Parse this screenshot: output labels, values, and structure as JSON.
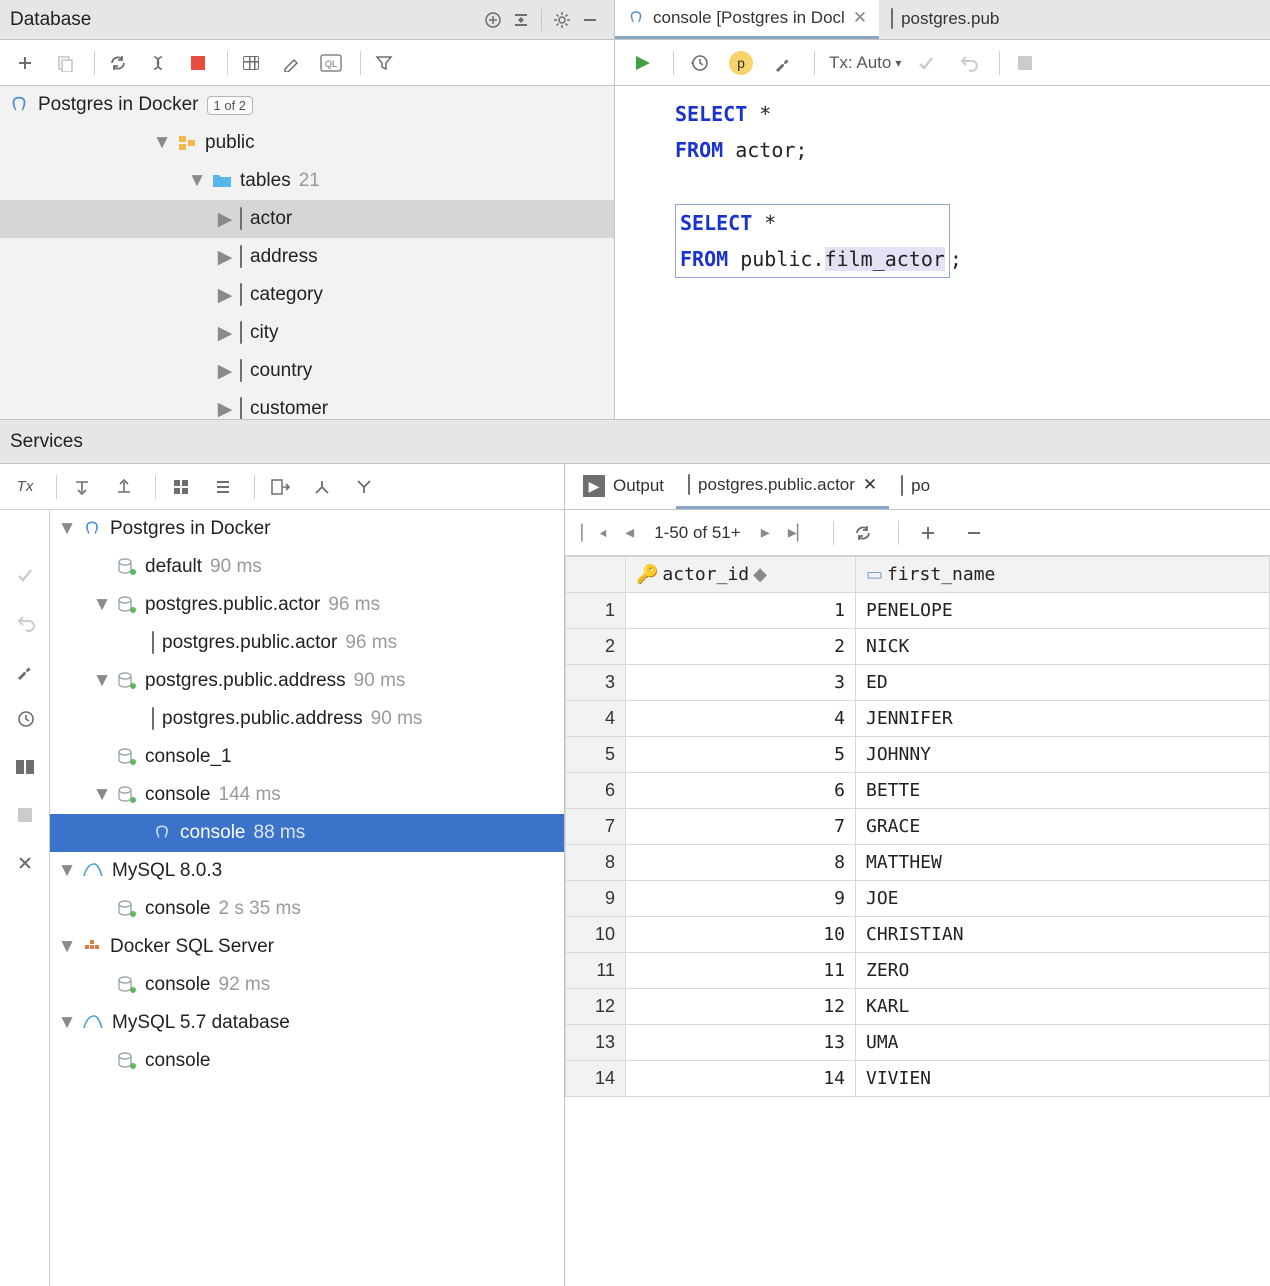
{
  "db_panel": {
    "title": "Database",
    "root": {
      "label": "Postgres in Docker",
      "pill": "1 of 2"
    },
    "schema": "public",
    "tables_label": "tables",
    "tables_count": "21",
    "tables": [
      "actor",
      "address",
      "category",
      "city",
      "country",
      "customer"
    ],
    "selected_table_index": 0
  },
  "editor": {
    "tabs": [
      {
        "label": "console [Postgres in Docl",
        "active": true,
        "closable": true,
        "icon": "elephant"
      },
      {
        "label": "postgres.pub",
        "active": false,
        "closable": false,
        "icon": "table"
      }
    ],
    "tx_label": "Tx: Auto",
    "code": {
      "l1_kw": "SELECT",
      "l1_rest": " *",
      "l2_kw": "FROM",
      "l2_rest": " actor;",
      "l3_kw": "SELECT",
      "l3_rest": " *",
      "l4_kw": "FROM",
      "l4_mid": " public.",
      "l4_hl": "film_actor",
      "l4_end": ";"
    }
  },
  "services": {
    "title": "Services",
    "tx_label": "Tx",
    "tree": [
      {
        "depth": 0,
        "arrow": "down",
        "icon": "elephant-blue",
        "label": "Postgres in Docker",
        "meta": ""
      },
      {
        "depth": 1,
        "arrow": "",
        "icon": "datasource",
        "label": "default",
        "meta": "90 ms"
      },
      {
        "depth": 1,
        "arrow": "down",
        "icon": "datasource",
        "label": "postgres.public.actor",
        "meta": "96 ms"
      },
      {
        "depth": 2,
        "arrow": "",
        "icon": "table",
        "label": "postgres.public.actor",
        "meta": "96 ms"
      },
      {
        "depth": 1,
        "arrow": "down",
        "icon": "datasource",
        "label": "postgres.public.address",
        "meta": "90 ms"
      },
      {
        "depth": 2,
        "arrow": "",
        "icon": "table",
        "label": "postgres.public.address",
        "meta": "90 ms"
      },
      {
        "depth": 1,
        "arrow": "",
        "icon": "datasource",
        "label": "console_1",
        "meta": ""
      },
      {
        "depth": 1,
        "arrow": "down",
        "icon": "datasource",
        "label": "console",
        "meta": "144 ms"
      },
      {
        "depth": 2,
        "arrow": "",
        "icon": "elephant-grey",
        "label": "console",
        "meta": "88 ms",
        "selected": true
      },
      {
        "depth": 0,
        "arrow": "down",
        "icon": "mysql",
        "label": "MySQL 8.0.3",
        "meta": ""
      },
      {
        "depth": 1,
        "arrow": "",
        "icon": "datasource",
        "label": "console",
        "meta": "2 s 35 ms"
      },
      {
        "depth": 0,
        "arrow": "down",
        "icon": "docker",
        "label": "Docker SQL Server",
        "meta": ""
      },
      {
        "depth": 1,
        "arrow": "",
        "icon": "datasource",
        "label": "console",
        "meta": "92 ms"
      },
      {
        "depth": 0,
        "arrow": "down",
        "icon": "mysql",
        "label": "MySQL 5.7 database",
        "meta": ""
      },
      {
        "depth": 1,
        "arrow": "",
        "icon": "datasource",
        "label": "console",
        "meta": ""
      }
    ]
  },
  "results": {
    "tabs": [
      {
        "label": "Output",
        "icon": "output",
        "active": false,
        "closable": false
      },
      {
        "label": "postgres.public.actor",
        "icon": "table",
        "active": true,
        "closable": true
      },
      {
        "label": "po",
        "icon": "table",
        "active": false,
        "closable": false
      }
    ],
    "range": "1-50 of 51+",
    "columns": [
      "actor_id",
      "first_name"
    ],
    "rows": [
      {
        "n": 1,
        "id": 1,
        "name": "PENELOPE"
      },
      {
        "n": 2,
        "id": 2,
        "name": "NICK"
      },
      {
        "n": 3,
        "id": 3,
        "name": "ED"
      },
      {
        "n": 4,
        "id": 4,
        "name": "JENNIFER"
      },
      {
        "n": 5,
        "id": 5,
        "name": "JOHNNY"
      },
      {
        "n": 6,
        "id": 6,
        "name": "BETTE"
      },
      {
        "n": 7,
        "id": 7,
        "name": "GRACE"
      },
      {
        "n": 8,
        "id": 8,
        "name": "MATTHEW"
      },
      {
        "n": 9,
        "id": 9,
        "name": "JOE"
      },
      {
        "n": 10,
        "id": 10,
        "name": "CHRISTIAN"
      },
      {
        "n": 11,
        "id": 11,
        "name": "ZERO"
      },
      {
        "n": 12,
        "id": 12,
        "name": "KARL"
      },
      {
        "n": 13,
        "id": 13,
        "name": "UMA"
      },
      {
        "n": 14,
        "id": 14,
        "name": "VIVIEN"
      }
    ]
  }
}
